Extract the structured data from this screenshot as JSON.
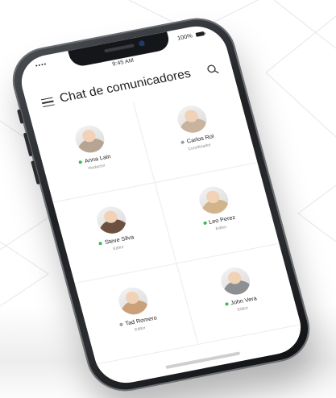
{
  "status_bar": {
    "carrier": "•••• ",
    "time": "9:45 AM",
    "battery": "100%"
  },
  "header": {
    "title": "Chat de comunicadores",
    "menu_icon": "hamburger-menu-icon",
    "search_icon": "search-icon"
  },
  "colors": {
    "online": "#3cba54",
    "offline": "#9aa0a6",
    "phone_frame": "#1e2024",
    "screen_bg": "#ffffff"
  },
  "contacts": [
    {
      "name": "Anna Lain",
      "role": "Redactor",
      "status": "online",
      "avatar_color": "#b7a493"
    },
    {
      "name": "Carlos Rol",
      "role": "Coordinador",
      "status": "offline",
      "avatar_color": "#c8b39c"
    },
    {
      "name": "Steve Silva",
      "role": "Editor",
      "status": "online",
      "avatar_color": "#6d5140"
    },
    {
      "name": "Leo Perez",
      "role": "Editor",
      "status": "online",
      "avatar_color": "#d2b48c"
    },
    {
      "name": "Tad Romero",
      "role": "Editor",
      "status": "offline",
      "avatar_color": "#caa07a"
    },
    {
      "name": "John Vera",
      "role": "Editor",
      "status": "online",
      "avatar_color": "#8d8f92"
    }
  ]
}
